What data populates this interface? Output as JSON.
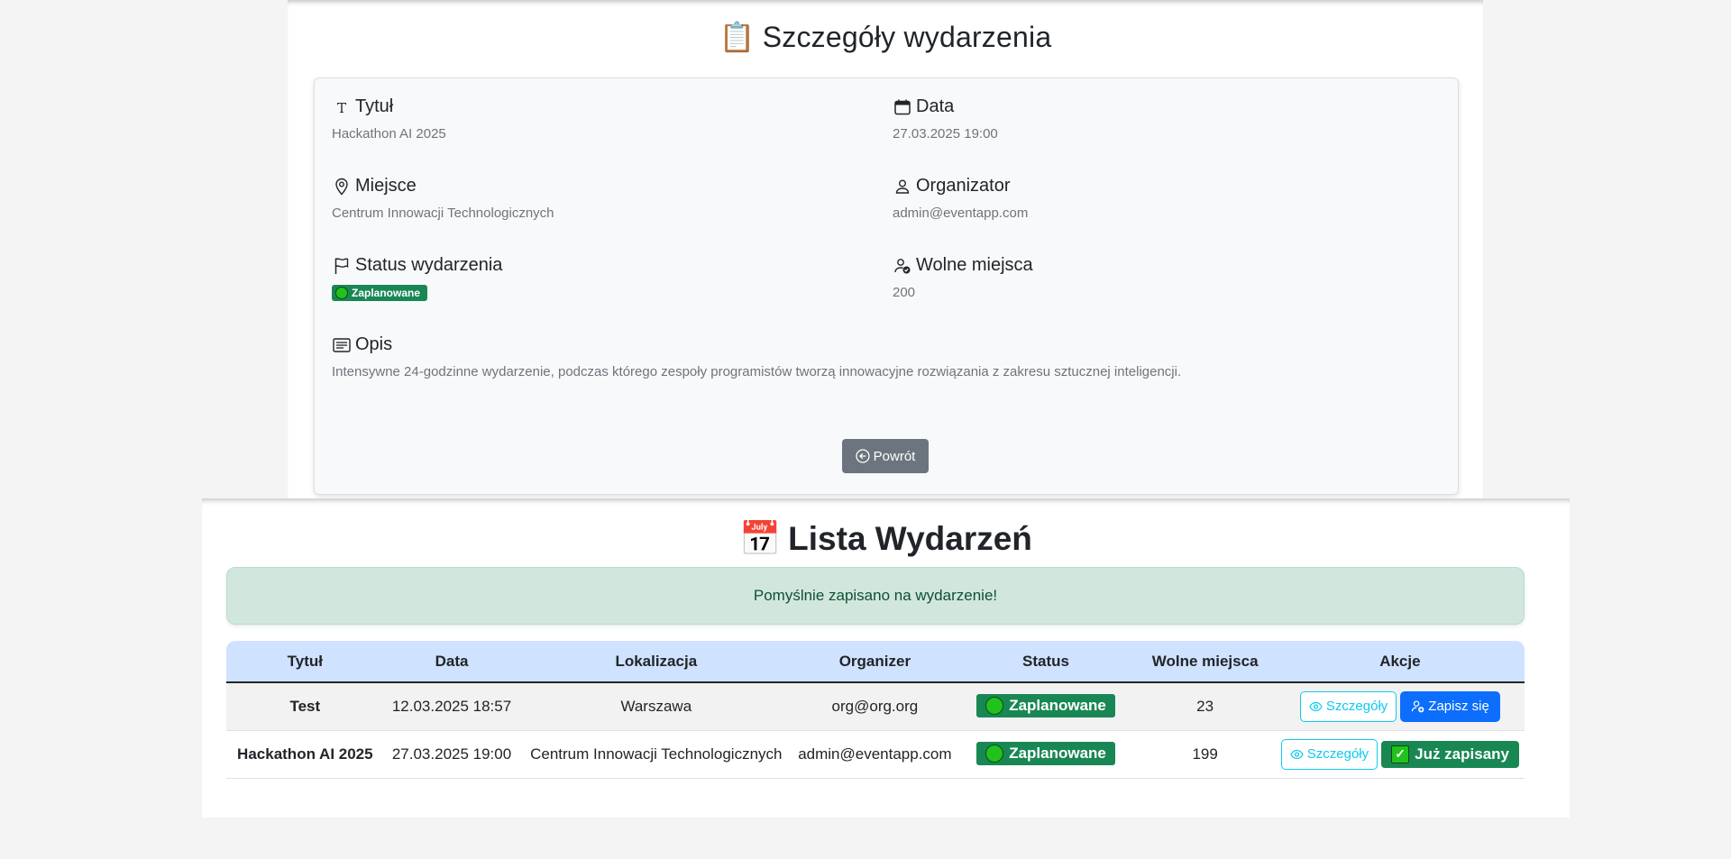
{
  "details": {
    "title": "Szczegóły wydarzenia",
    "title_icon": "📋",
    "fields": {
      "title": {
        "label": "Tytuł",
        "value": "Hackathon AI 2025",
        "icon": "text-icon"
      },
      "date": {
        "label": "Data",
        "value": "27.03.2025 19:00",
        "icon": "calendar-icon"
      },
      "place": {
        "label": "Miejsce",
        "value": "Centrum Innowacji Technologicznych",
        "icon": "location-pin-icon"
      },
      "organizer": {
        "label": "Organizator",
        "value": "admin@eventapp.com",
        "icon": "person-icon"
      },
      "status": {
        "label": "Status wydarzenia",
        "value": "Zaplanowane",
        "icon": "flag-icon"
      },
      "seats": {
        "label": "Wolne miejsca",
        "value": "200",
        "icon": "person-check-icon"
      },
      "description": {
        "label": "Opis",
        "value": "Intensywne 24-godzinne wydarzenie, podczas którego zespoły programistów tworzą innowacyjne rozwiązania z zakresu sztucznej inteligencji.",
        "icon": "card-text-icon"
      }
    },
    "back_label": "Powrót"
  },
  "list": {
    "title": "Lista Wydarzeń",
    "title_icon": "📅",
    "alert": "Pomyślnie zapisano na wydarzenie!",
    "columns": [
      "Tytuł",
      "Data",
      "Lokalizacja",
      "Organizer",
      "Status",
      "Wolne miejsca",
      "Akcje"
    ],
    "rows": [
      {
        "title": "Test",
        "date": "12.03.2025 18:57",
        "location": "Warszawa",
        "organizer": "org@org.org",
        "status": "Zaplanowane",
        "seats": "23",
        "details_label": "Szczegóły",
        "action_label": "Zapisz się"
      },
      {
        "title": "Hackathon AI 2025",
        "date": "27.03.2025 19:00",
        "location": "Centrum Innowacji Technologicznych",
        "organizer": "admin@eventapp.com",
        "status": "Zaplanowane",
        "seats": "199",
        "details_label": "Szczegóły",
        "action_label": "Już zapisany"
      }
    ]
  },
  "colors": {
    "success": "#198754",
    "primary": "#0d6efd",
    "info": "#0dcaf0",
    "secondary": "#6c757d",
    "alert_bg": "#d1e7dd",
    "table_header_bg": "#cfe2ff"
  }
}
